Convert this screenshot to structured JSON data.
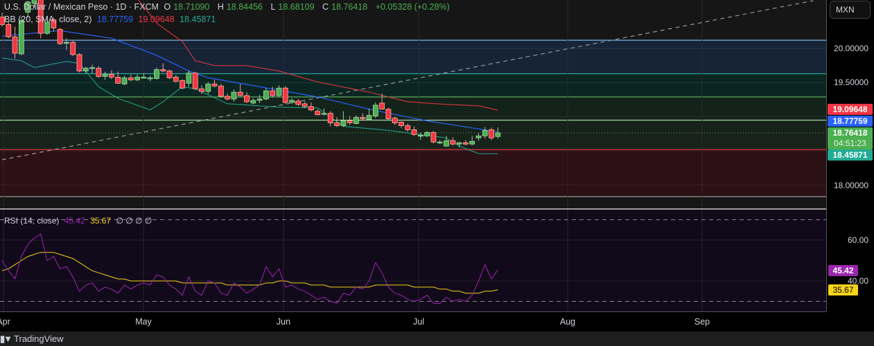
{
  "header": {
    "symbol": "U.S. Dollar / Mexican Peso · 1D · FXCM",
    "o_label": "O",
    "o": "18.71090",
    "h_label": "H",
    "h": "18.84456",
    "l_label": "L",
    "l": "18.68109",
    "c_label": "C",
    "c": "18.76418",
    "change": "+0.05328 (+0.28%)"
  },
  "bb": {
    "label": "BB (20, SMA, close, 2)",
    "basis": "18.77759",
    "upper": "19.09648",
    "lower": "18.45871"
  },
  "rsi": {
    "label": "RSI (14, close)",
    "value": "45.42",
    "ma": "35.67",
    "extras": "∅ ∅ ∅ ∅"
  },
  "price_axis": {
    "currency": "MXN",
    "ticks": [
      "20.00000",
      "19.50000",
      "18.00000"
    ],
    "labels": {
      "upper": "19.09648",
      "basis": "18.77759",
      "last": "18.76418",
      "countdown": "04:51:23",
      "lower": "18.45871"
    }
  },
  "rsi_axis": {
    "ticks": [
      "60.00",
      "40.00"
    ],
    "labels": {
      "rsi": "45.42",
      "ma": "35.67"
    }
  },
  "time_axis": [
    "Apr",
    "May",
    "Jun",
    "Jul",
    "Aug",
    "Sep"
  ],
  "footer": {
    "brand": "TradingView"
  },
  "colors": {
    "up": "#4caf50",
    "down": "#f23645",
    "basis": "#2962ff",
    "upper": "#f23645",
    "lower": "#22ab94",
    "rsi": "#9c27b0",
    "rsi_ma": "#f7d31b"
  },
  "chart_data": [
    {
      "type": "candlestick",
      "title": "U.S. Dollar / Mexican Peso · 1D · FXCM",
      "ylim": [
        17.75,
        20.7
      ],
      "y_ticks": [
        20.0,
        19.5,
        18.0
      ],
      "x_ticks": [
        "Apr",
        "May",
        "Jun",
        "Jul",
        "Aug",
        "Sep"
      ],
      "ohlc": [
        [
          20.46,
          20.52,
          20.32,
          20.35
        ],
        [
          20.35,
          20.4,
          20.15,
          20.17
        ],
        [
          20.17,
          20.32,
          19.85,
          19.93
        ],
        [
          19.92,
          20.45,
          19.9,
          20.41
        ],
        [
          20.53,
          20.7,
          20.45,
          20.68
        ],
        [
          20.66,
          20.8,
          20.6,
          20.76
        ],
        [
          20.76,
          20.8,
          20.15,
          20.22
        ],
        [
          20.22,
          20.45,
          20.2,
          20.38
        ],
        [
          20.42,
          20.45,
          20.25,
          20.3
        ],
        [
          20.28,
          20.3,
          20.05,
          20.07
        ],
        [
          20.08,
          20.15,
          19.98,
          20.09
        ],
        [
          20.09,
          20.11,
          19.89,
          19.91
        ],
        [
          19.91,
          19.93,
          19.65,
          19.67
        ],
        [
          19.67,
          19.73,
          19.64,
          19.71
        ],
        [
          19.71,
          19.76,
          19.63,
          19.72
        ],
        [
          19.71,
          19.74,
          19.57,
          19.59
        ],
        [
          19.59,
          19.66,
          19.54,
          19.62
        ],
        [
          19.62,
          19.68,
          19.55,
          19.58
        ],
        [
          19.58,
          19.66,
          19.48,
          19.49
        ],
        [
          19.48,
          19.6,
          19.46,
          19.57
        ],
        [
          19.57,
          19.62,
          19.52,
          19.54
        ],
        [
          19.54,
          19.62,
          19.52,
          19.58
        ],
        [
          19.58,
          19.64,
          19.56,
          19.58
        ],
        [
          19.57,
          19.6,
          19.52,
          19.57
        ],
        [
          19.56,
          19.72,
          19.54,
          19.69
        ],
        [
          19.69,
          19.78,
          19.65,
          19.67
        ],
        [
          19.67,
          19.69,
          19.55,
          19.57
        ],
        [
          19.58,
          19.61,
          19.5,
          19.52
        ],
        [
          19.53,
          19.55,
          19.4,
          19.42
        ],
        [
          19.49,
          19.68,
          19.44,
          19.64
        ],
        [
          19.64,
          19.66,
          19.39,
          19.41
        ],
        [
          19.41,
          19.46,
          19.33,
          19.37
        ],
        [
          19.37,
          19.51,
          19.33,
          19.48
        ],
        [
          19.48,
          19.54,
          19.43,
          19.45
        ],
        [
          19.45,
          19.48,
          19.28,
          19.3
        ],
        [
          19.3,
          19.34,
          19.24,
          19.26
        ],
        [
          19.26,
          19.4,
          19.22,
          19.36
        ],
        [
          19.36,
          19.48,
          19.3,
          19.31
        ],
        [
          19.31,
          19.36,
          19.2,
          19.22
        ],
        [
          19.2,
          19.27,
          19.18,
          19.24
        ],
        [
          19.24,
          19.32,
          19.2,
          19.26
        ],
        [
          19.26,
          19.42,
          19.24,
          19.38
        ],
        [
          19.38,
          19.44,
          19.28,
          19.31
        ],
        [
          19.31,
          19.46,
          19.29,
          19.42
        ],
        [
          19.42,
          19.45,
          19.19,
          19.21
        ],
        [
          19.21,
          19.27,
          19.19,
          19.24
        ],
        [
          19.23,
          19.26,
          19.16,
          19.18
        ],
        [
          19.19,
          19.22,
          19.13,
          19.15
        ],
        [
          19.15,
          19.21,
          19.08,
          19.1
        ],
        [
          19.08,
          19.11,
          19.02,
          19.03
        ],
        [
          19.05,
          19.12,
          19.02,
          19.05
        ],
        [
          19.05,
          19.08,
          18.86,
          18.91
        ],
        [
          18.91,
          18.99,
          18.85,
          18.87
        ],
        [
          18.87,
          19.08,
          18.85,
          18.94
        ],
        [
          18.94,
          19.01,
          18.88,
          18.91
        ],
        [
          18.9,
          19.02,
          18.89,
          18.99
        ],
        [
          18.99,
          19.05,
          18.95,
          18.97
        ],
        [
          18.96,
          19.12,
          18.95,
          19.02
        ],
        [
          19.01,
          19.21,
          18.98,
          19.17
        ],
        [
          19.2,
          19.34,
          19.15,
          19.11
        ],
        [
          19.11,
          19.13,
          18.95,
          18.97
        ],
        [
          18.98,
          19.0,
          18.88,
          18.91
        ],
        [
          18.92,
          18.93,
          18.84,
          18.87
        ],
        [
          18.87,
          18.9,
          18.78,
          18.81
        ],
        [
          18.81,
          18.86,
          18.72,
          18.74
        ],
        [
          18.73,
          18.77,
          18.66,
          18.73
        ],
        [
          18.72,
          18.79,
          18.7,
          18.77
        ],
        [
          18.77,
          18.79,
          18.61,
          18.63
        ],
        [
          18.63,
          18.66,
          18.6,
          18.63
        ],
        [
          18.57,
          18.72,
          18.56,
          18.65
        ],
        [
          18.65,
          18.7,
          18.58,
          18.6
        ],
        [
          18.6,
          18.63,
          18.55,
          18.62
        ],
        [
          18.62,
          18.66,
          18.58,
          18.6
        ],
        [
          18.6,
          18.72,
          18.58,
          18.64
        ],
        [
          18.69,
          18.76,
          18.65,
          18.72
        ],
        [
          18.72,
          18.85,
          18.68,
          18.8
        ],
        [
          18.81,
          18.84,
          18.66,
          18.69
        ],
        [
          18.7109,
          18.84456,
          18.68109,
          18.76418
        ]
      ],
      "bb_basis": [
        [
          0,
          20.18
        ],
        [
          9,
          20.26
        ],
        [
          17,
          20.15
        ],
        [
          24,
          19.9
        ],
        [
          29,
          19.67
        ],
        [
          32,
          19.57
        ],
        [
          43,
          19.39
        ],
        [
          49,
          19.29
        ],
        [
          58,
          19.09
        ],
        [
          66,
          18.94
        ],
        [
          77,
          18.77759
        ]
      ],
      "bb_upper": [
        [
          0,
          20.95
        ],
        [
          10,
          21.05
        ],
        [
          20,
          20.85
        ],
        [
          24,
          20.37
        ],
        [
          28,
          20.1
        ],
        [
          30,
          19.82
        ],
        [
          33,
          19.75
        ],
        [
          38,
          19.75
        ],
        [
          43,
          19.67
        ],
        [
          49,
          19.51
        ],
        [
          57,
          19.36
        ],
        [
          63,
          19.22
        ],
        [
          69,
          19.18
        ],
        [
          74,
          19.16
        ],
        [
          77,
          19.09648
        ]
      ],
      "bb_lower": [
        [
          0,
          19.86
        ],
        [
          3,
          19.82
        ],
        [
          5,
          19.72
        ],
        [
          10,
          19.81
        ],
        [
          12,
          19.78
        ],
        [
          15,
          19.44
        ],
        [
          18,
          19.27
        ],
        [
          23,
          19.1
        ],
        [
          25,
          19.22
        ],
        [
          28,
          19.44
        ],
        [
          30,
          19.41
        ],
        [
          35,
          19.19
        ],
        [
          43,
          19.14
        ],
        [
          49,
          19.13
        ],
        [
          53,
          18.86
        ],
        [
          60,
          18.8
        ],
        [
          64,
          18.75
        ],
        [
          69,
          18.69
        ],
        [
          71,
          18.57
        ],
        [
          74,
          18.46
        ],
        [
          77,
          18.45871
        ]
      ],
      "zones": [
        {
          "from": 20.12,
          "to": 19.63,
          "color": "#172437",
          "line": "#7fb5e6"
        },
        {
          "from": 19.63,
          "to": 19.29,
          "color": "#0b2622",
          "line": "#26a69a"
        },
        {
          "from": 19.29,
          "to": 18.95,
          "color": "#14231a",
          "line": "#66bb6a"
        },
        {
          "from": 18.95,
          "to": 18.52,
          "color": "#17231a",
          "line": "#a5d6a7"
        },
        {
          "from": 18.52,
          "to": 17.83,
          "color": "#2b1015",
          "line": "#f23645"
        }
      ],
      "trendline": [
        [
          0,
          18.37
        ],
        [
          126,
          20.7
        ]
      ]
    },
    {
      "type": "line",
      "title": "RSI (14, close)",
      "ylim": [
        25,
        72
      ],
      "y_ticks": [
        60,
        40
      ],
      "bands": [
        70,
        30
      ],
      "series": [
        {
          "name": "RSI",
          "values": [
            50,
            45,
            41,
            52,
            58,
            61,
            63,
            50,
            52,
            46,
            47,
            42,
            35,
            38,
            39,
            35,
            37,
            36,
            34,
            38,
            36,
            38,
            39,
            38,
            43,
            42,
            38,
            36,
            33,
            42,
            35,
            33,
            40,
            39,
            34,
            33,
            39,
            37,
            34,
            36,
            38,
            47,
            42,
            46,
            37,
            38,
            36,
            35,
            33,
            31,
            32,
            30,
            29,
            34,
            33,
            37,
            36,
            40,
            49,
            44,
            37,
            34,
            33,
            31,
            30,
            31,
            33,
            29,
            29,
            32,
            30,
            31,
            30,
            33,
            40,
            48,
            41,
            45.42
          ]
        },
        {
          "name": "RSI-based MA",
          "values": [
            45,
            46,
            48,
            50,
            52,
            53,
            54,
            54,
            54,
            53,
            52,
            51,
            49,
            47,
            45,
            44,
            43,
            42,
            41,
            41,
            40,
            40,
            40,
            40,
            40,
            40,
            40,
            40,
            39,
            39,
            39,
            39,
            39,
            39,
            39,
            38,
            38,
            38,
            38,
            38,
            38,
            39,
            39,
            40,
            40,
            39,
            39,
            39,
            38,
            38,
            38,
            37,
            37,
            37,
            37,
            37,
            37,
            37,
            38,
            38,
            38,
            38,
            38,
            38,
            37,
            37,
            37,
            37,
            36,
            36,
            35,
            35,
            34,
            34,
            34,
            35,
            35,
            35.67
          ]
        }
      ]
    }
  ]
}
